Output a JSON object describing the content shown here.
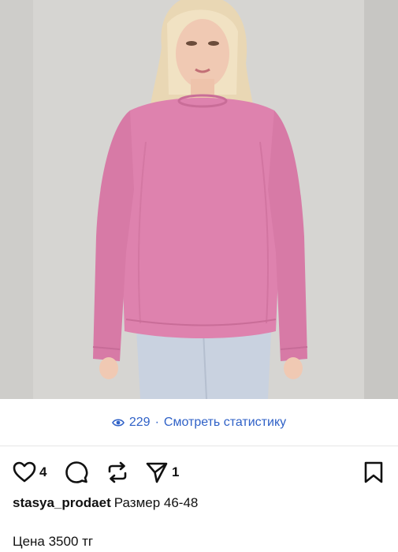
{
  "post": {
    "image_alt": "Blonde woman wearing pink long-sleeve oversized sweatshirt and light jeans",
    "stats": {
      "views": "229",
      "separator": "·",
      "link_label": "Смотреть статистику"
    },
    "actions": {
      "likes": "4",
      "reposts": "",
      "shares": "1"
    },
    "caption": {
      "username": "stasya_prodaet",
      "text": "Размер 46-48",
      "price_line": "Цена 3500 тг"
    }
  },
  "colors": {
    "link_blue": "#2f61c7",
    "sweater_pink": "#de82ae",
    "background_wall": "#d7d6d3"
  },
  "icons": [
    "eye-icon",
    "heart-icon",
    "comment-icon",
    "repost-icon",
    "send-icon",
    "bookmark-icon"
  ]
}
